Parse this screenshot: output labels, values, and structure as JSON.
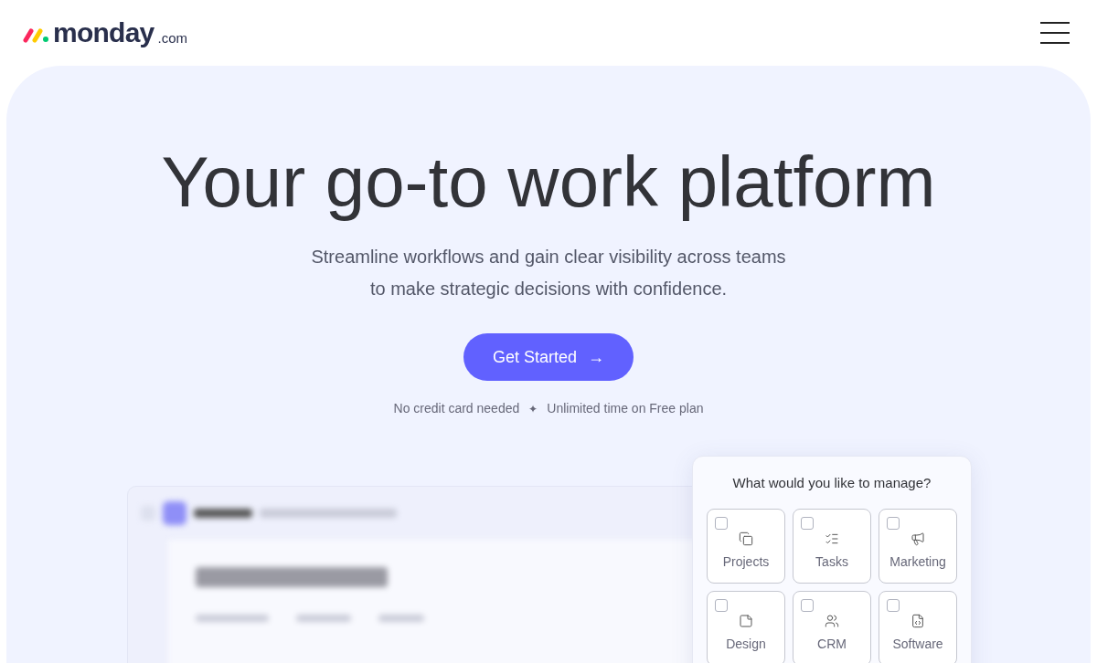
{
  "header": {
    "logo_text": "monday",
    "logo_suffix": ".com"
  },
  "hero": {
    "title": "Your go-to work platform",
    "subtitle_lines": [
      "Streamline workflows and gain clear visibility across teams",
      "to make strategic decisions with confidence."
    ],
    "cta": "Get Started",
    "cta_arrow": "→",
    "notes": [
      "No credit card needed",
      "Unlimited time on Free plan"
    ],
    "note_separator": "✦"
  },
  "picker": {
    "title": "What would you like to manage?",
    "options": [
      {
        "kind": "projects",
        "label": "Projects",
        "checked": false
      },
      {
        "kind": "tasks",
        "label": "Tasks",
        "checked": false
      },
      {
        "kind": "marketing",
        "label": "Marketing",
        "checked": false
      },
      {
        "kind": "design",
        "label": "Design",
        "checked": false
      },
      {
        "kind": "crm",
        "label": "CRM",
        "checked": false
      },
      {
        "kind": "software",
        "label": "Software",
        "checked": false
      }
    ]
  }
}
